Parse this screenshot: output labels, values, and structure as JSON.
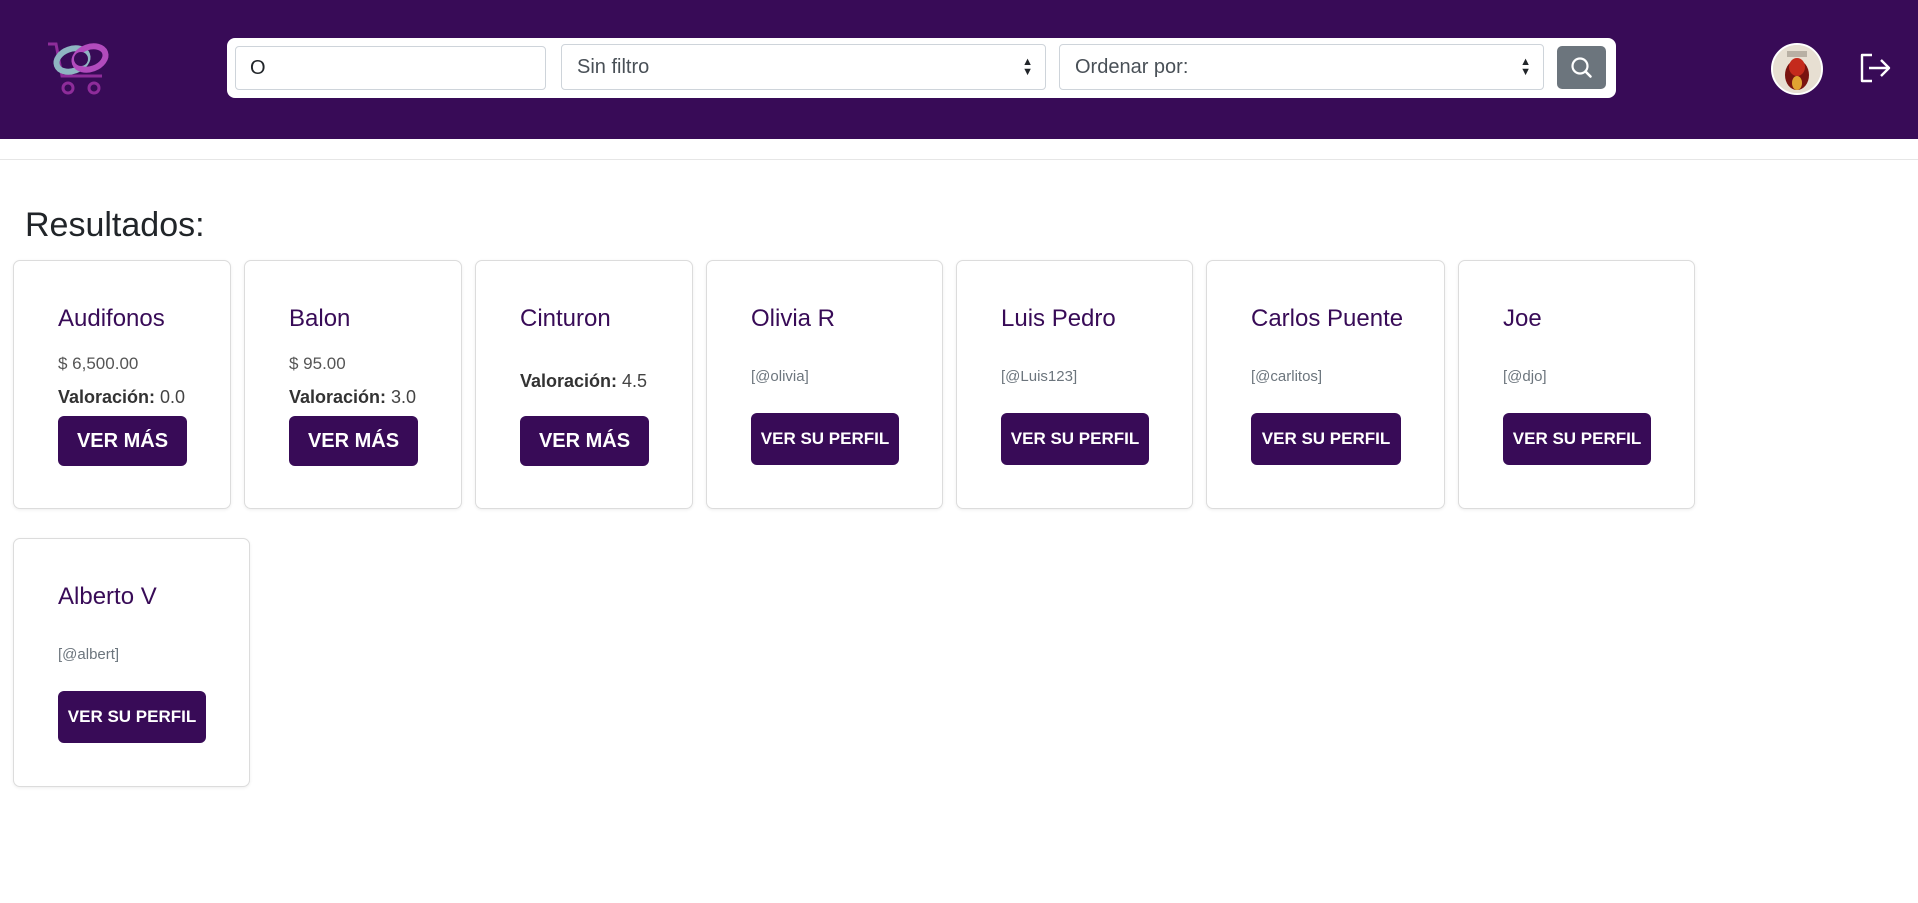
{
  "header": {
    "logo_alt": "Links to Shop logo",
    "search": {
      "value": "O"
    },
    "filter_select": {
      "selected": "Sin filtro"
    },
    "order_select": {
      "selected": "Ordenar por:"
    },
    "icons": {
      "search": "search-icon",
      "logout": "logout-icon",
      "avatar": "user-avatar"
    }
  },
  "main": {
    "title": "Resultados:",
    "products": [
      {
        "name": "Audifonos",
        "price": "$ 6,500.00",
        "rating_label": "Valoración:",
        "rating": "0.0",
        "button": "VER MÁS"
      },
      {
        "name": "Balon",
        "price": "$ 95.00",
        "rating_label": "Valoración:",
        "rating": "3.0",
        "button": "VER MÁS"
      },
      {
        "name": "Cinturon",
        "rating_label": "Valoración:",
        "rating": "4.5",
        "button": "VER MÁS"
      }
    ],
    "users": [
      {
        "name": "Olivia R",
        "handle": "[@olivia]",
        "button": "VER SU PERFIL"
      },
      {
        "name": "Luis Pedro",
        "handle": "[@Luis123]",
        "button": "VER SU PERFIL"
      },
      {
        "name": "Carlos Puente",
        "handle": "[@carlitos]",
        "button": "VER SU PERFIL"
      },
      {
        "name": "Joe",
        "handle": "[@djo]",
        "button": "VER SU PERFIL"
      },
      {
        "name": "Alberto V",
        "handle": "[@albert]",
        "button": "VER SU PERFIL"
      }
    ]
  },
  "colors": {
    "brand": "#380b57",
    "search_button": "#6c757d",
    "page_bg": "#ffffff"
  }
}
